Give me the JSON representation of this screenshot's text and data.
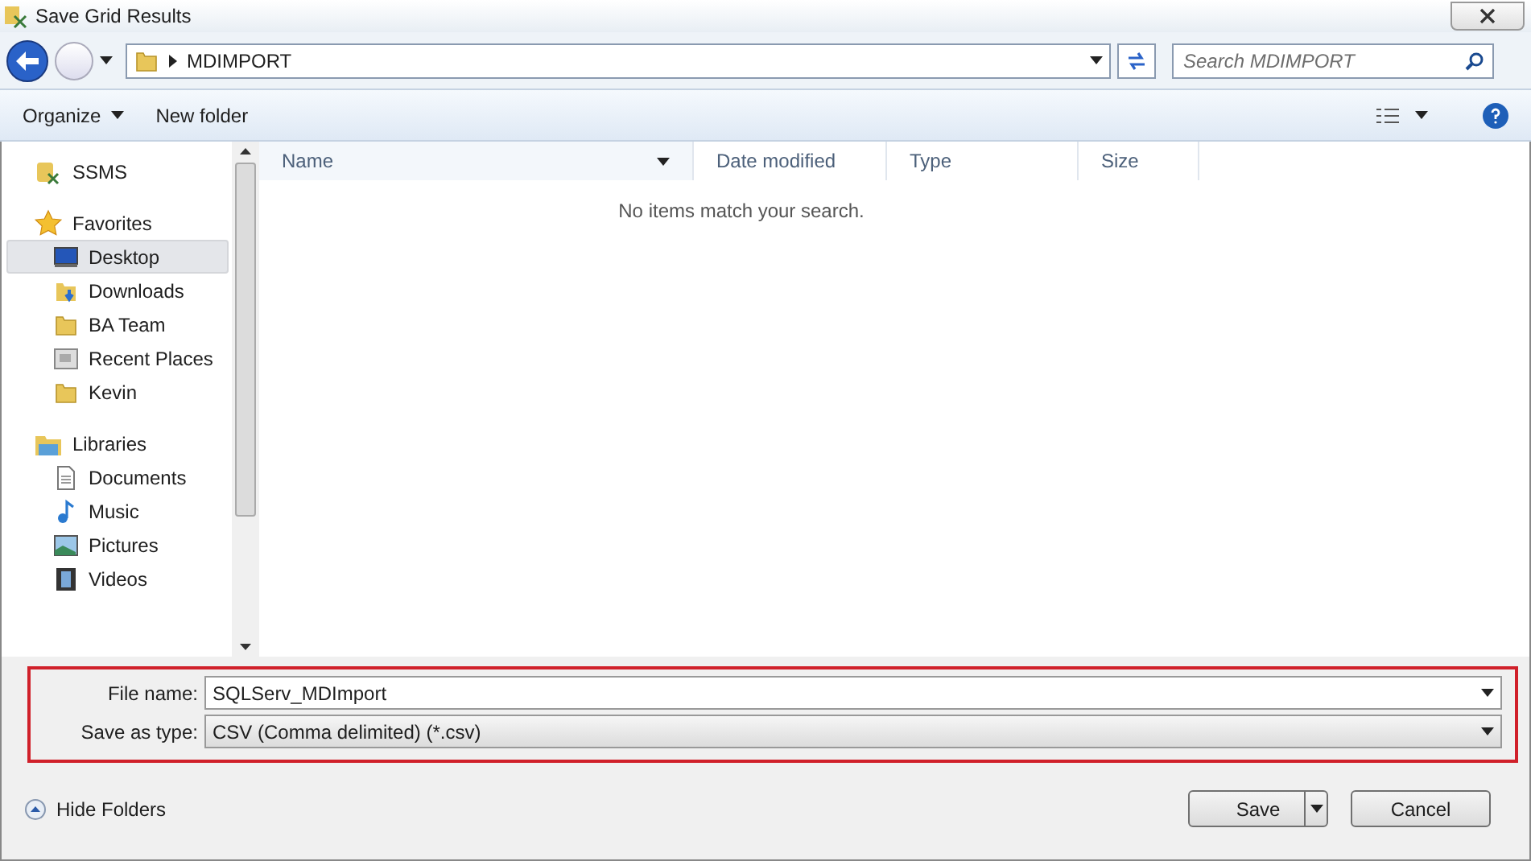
{
  "window": {
    "title": "Save Grid Results"
  },
  "address": {
    "path": "MDIMPORT"
  },
  "search": {
    "placeholder": "Search MDIMPORT"
  },
  "toolbar": {
    "organize": "Organize",
    "new_folder": "New folder"
  },
  "sidebar": {
    "items": [
      {
        "label": "SSMS",
        "selected": false
      },
      {
        "label": "Favorites",
        "selected": false,
        "children": [
          {
            "label": "Desktop",
            "selected": true
          },
          {
            "label": "Downloads",
            "selected": false
          },
          {
            "label": "BA Team",
            "selected": false
          },
          {
            "label": "Recent Places",
            "selected": false
          },
          {
            "label": "Kevin",
            "selected": false
          }
        ]
      },
      {
        "label": "Libraries",
        "selected": false,
        "children": [
          {
            "label": "Documents",
            "selected": false
          },
          {
            "label": "Music",
            "selected": false
          },
          {
            "label": "Pictures",
            "selected": false
          },
          {
            "label": "Videos",
            "selected": false
          }
        ]
      }
    ]
  },
  "table": {
    "columns": [
      "Name",
      "Date modified",
      "Type",
      "Size"
    ],
    "empty_message": "No items match your search."
  },
  "form": {
    "file_name_label": "File name:",
    "file_name": "SQLServ_MDImport",
    "type_label": "Save as type:",
    "type": "CSV (Comma delimited) (*.csv)"
  },
  "footer": {
    "hide_folders": "Hide Folders",
    "buttons": [
      "Save",
      "Cancel"
    ]
  }
}
